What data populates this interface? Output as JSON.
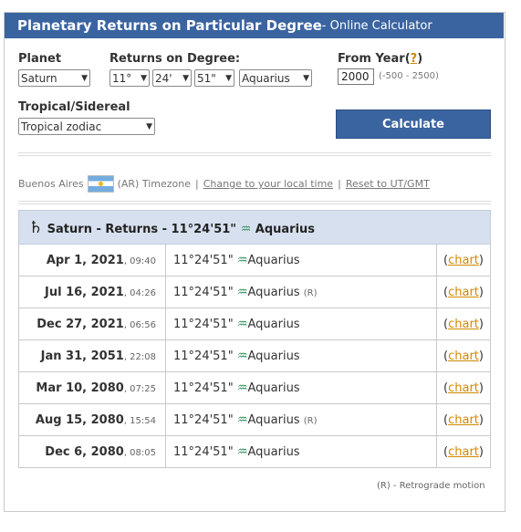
{
  "header": {
    "title": "Planetary Returns on Particular Degree",
    "subtitle": " - Online Calculator"
  },
  "form": {
    "planet_label": "Planet",
    "planet_value": "Saturn",
    "returns_label": "Returns on Degree:",
    "degree_value": "11°",
    "minute_value": "24'",
    "second_value": "51\"",
    "sign_value": "Aquarius",
    "from_year_label": "From Year",
    "help_mark": "?",
    "year_value": "2000",
    "year_range": "(-500 - 2500)",
    "tropical_label": "Tropical/Sidereal",
    "zodiac_value": "Tropical zodiac",
    "calculate_label": "Calculate"
  },
  "timezone": {
    "city": "Buenos Aires",
    "code_text": "(AR) Timezone",
    "change_link": "Change to your local time",
    "reset_link": "Reset to UT/GMT",
    "sep1": "|",
    "sep2": "|"
  },
  "results": {
    "planet_glyph": "♄",
    "heading": "Saturn - Returns - 11°24'51\"",
    "sign_glyph": "♒",
    "sign_name": "Aquarius",
    "rows": [
      {
        "date": "Apr 1, 2021",
        "time": ", 09:40",
        "deg": "11°24'51\"",
        "glyph": "♒",
        "sign": "Aquarius",
        "retro": "",
        "chart": "chart"
      },
      {
        "date": "Jul 16, 2021",
        "time": ", 04:26",
        "deg": "11°24'51\"",
        "glyph": "♒",
        "sign": "Aquarius",
        "retro": "(R)",
        "chart": "chart"
      },
      {
        "date": "Dec 27, 2021",
        "time": ", 06:56",
        "deg": "11°24'51\"",
        "glyph": "♒",
        "sign": "Aquarius",
        "retro": "",
        "chart": "chart"
      },
      {
        "date": "Jan 31, 2051",
        "time": ", 22:08",
        "deg": "11°24'51\"",
        "glyph": "♒",
        "sign": "Aquarius",
        "retro": "",
        "chart": "chart"
      },
      {
        "date": "Mar 10, 2080",
        "time": ", 07:25",
        "deg": "11°24'51\"",
        "glyph": "♒",
        "sign": "Aquarius",
        "retro": "",
        "chart": "chart"
      },
      {
        "date": "Aug 15, 2080",
        "time": ", 15:54",
        "deg": "11°24'51\"",
        "glyph": "♒",
        "sign": "Aquarius",
        "retro": "(R)",
        "chart": "chart"
      },
      {
        "date": "Dec 6, 2080",
        "time": ", 08:05",
        "deg": "11°24'51\"",
        "glyph": "♒",
        "sign": "Aquarius",
        "retro": "",
        "chart": "chart"
      }
    ]
  },
  "footnote": "(R) - Retrograde motion",
  "colors": {
    "header_bg": "#3a64a0",
    "accent_link": "#d08a00",
    "table_head_bg": "#d7e0ee"
  }
}
